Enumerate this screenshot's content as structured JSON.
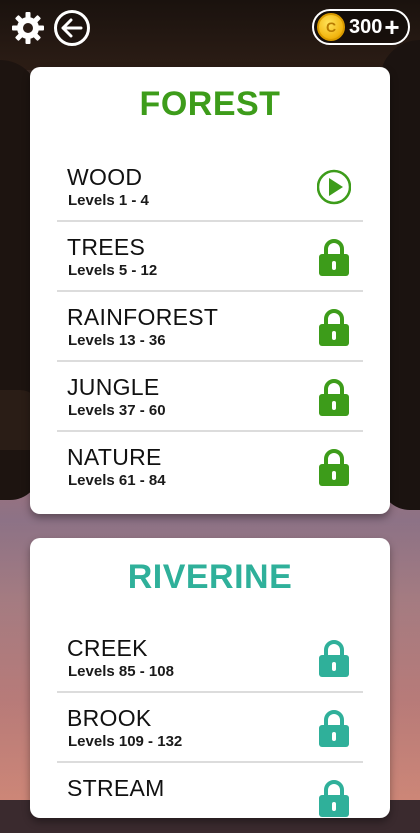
{
  "colors": {
    "forest_accent": "#3d9c1a",
    "riverine_accent": "#2fb09a",
    "coin": "#f1b40e"
  },
  "header": {
    "settings_icon": "gear-icon",
    "back_icon": "back-arrow-icon",
    "coins": {
      "symbol": "C",
      "count": "300",
      "add_label": "+"
    }
  },
  "worlds": [
    {
      "title": "FOREST",
      "packs": [
        {
          "name": "WOOD",
          "levels": "Levels 1 - 4",
          "status": "play",
          "icon": "play-icon"
        },
        {
          "name": "TREES",
          "levels": "Levels 5 - 12",
          "status": "locked",
          "icon": "lock-icon"
        },
        {
          "name": "RAINFOREST",
          "levels": "Levels 13 - 36",
          "status": "locked",
          "icon": "lock-icon"
        },
        {
          "name": "JUNGLE",
          "levels": "Levels 37 - 60",
          "status": "locked",
          "icon": "lock-icon"
        },
        {
          "name": "NATURE",
          "levels": "Levels 61 - 84",
          "status": "locked",
          "icon": "lock-icon"
        }
      ]
    },
    {
      "title": "RIVERINE",
      "packs": [
        {
          "name": "CREEK",
          "levels": "Levels 85 - 108",
          "status": "locked",
          "icon": "lock-icon"
        },
        {
          "name": "BROOK",
          "levels": "Levels 109 - 132",
          "status": "locked",
          "icon": "lock-icon"
        },
        {
          "name": "STREAM",
          "levels": "",
          "status": "locked",
          "icon": "lock-icon"
        }
      ]
    }
  ]
}
